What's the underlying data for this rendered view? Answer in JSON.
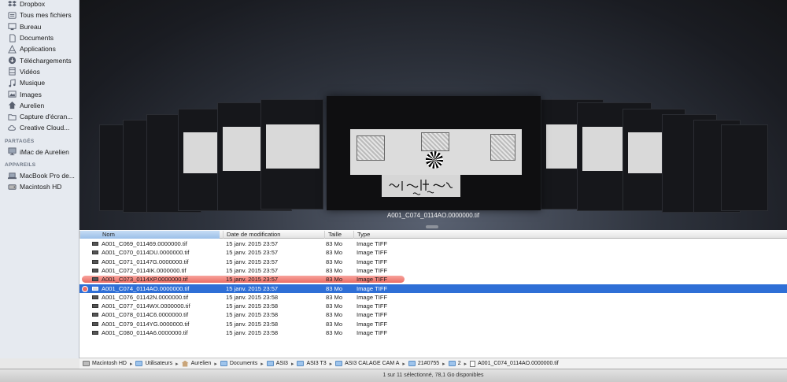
{
  "sidebar": {
    "favorites": [
      {
        "label": "Dropbox",
        "icon": "dropbox-icon"
      },
      {
        "label": "Tous mes fichiers",
        "icon": "all-files-icon"
      },
      {
        "label": "Bureau",
        "icon": "desktop-icon"
      },
      {
        "label": "Documents",
        "icon": "documents-icon"
      },
      {
        "label": "Applications",
        "icon": "applications-icon"
      },
      {
        "label": "Téléchargements",
        "icon": "downloads-icon"
      },
      {
        "label": "Vidéos",
        "icon": "movies-icon"
      },
      {
        "label": "Musique",
        "icon": "music-icon"
      },
      {
        "label": "Images",
        "icon": "pictures-icon"
      },
      {
        "label": "Aurelien",
        "icon": "home-icon"
      },
      {
        "label": "Capture d'écran...",
        "icon": "folder-icon"
      },
      {
        "label": "Creative Cloud...",
        "icon": "creative-cloud-icon"
      }
    ],
    "shared_heading": "PARTAGÉS",
    "shared": [
      {
        "label": "iMac de Aurelien",
        "icon": "imac-icon"
      }
    ],
    "devices_heading": "APPAREILS",
    "devices": [
      {
        "label": "MacBook Pro de...",
        "icon": "laptop-icon"
      },
      {
        "label": "Macintosh HD",
        "icon": "hard-drive-icon"
      }
    ]
  },
  "coverflow": {
    "caption": "A001_C074_0114AO.0000000.tif"
  },
  "columns": {
    "name": "Nom",
    "date": "Date de modification",
    "size": "Taille",
    "type": "Type"
  },
  "files": [
    {
      "name": "A001_C069_011469.0000000.tif",
      "date": "15 janv. 2015 23:57",
      "size": "83 Mo",
      "type": "Image TIFF"
    },
    {
      "name": "A001_C070_0114DU.0000000.tif",
      "date": "15 janv. 2015 23:57",
      "size": "83 Mo",
      "type": "Image TIFF"
    },
    {
      "name": "A001_C071_01147G.0000000.tif",
      "date": "15 janv. 2015 23:57",
      "size": "83 Mo",
      "type": "Image TIFF"
    },
    {
      "name": "A001_C072_0114IK.0000000.tif",
      "date": "15 janv. 2015 23:57",
      "size": "83 Mo",
      "type": "Image TIFF"
    },
    {
      "name": "A001_C073_0114XP.0000000.tif",
      "date": "15 janv. 2015 23:57",
      "size": "83 Mo",
      "type": "Image TIFF"
    },
    {
      "name": "A001_C074_0114AO.0000000.tif",
      "date": "15 janv. 2015 23:57",
      "size": "83 Mo",
      "type": "Image TIFF"
    },
    {
      "name": "A001_C076_01142N.0000000.tif",
      "date": "15 janv. 2015 23:58",
      "size": "83 Mo",
      "type": "Image TIFF"
    },
    {
      "name": "A001_C077_0114WX.0000000.tif",
      "date": "15 janv. 2015 23:58",
      "size": "83 Mo",
      "type": "Image TIFF"
    },
    {
      "name": "A001_C078_0114C6.0000000.tif",
      "date": "15 janv. 2015 23:58",
      "size": "83 Mo",
      "type": "Image TIFF"
    },
    {
      "name": "A001_C079_0114YG.0000000.tif",
      "date": "15 janv. 2015 23:58",
      "size": "83 Mo",
      "type": "Image TIFF"
    },
    {
      "name": "A001_C080_0114A6.0000000.tif",
      "date": "15 janv. 2015 23:58",
      "size": "83 Mo",
      "type": "Image TIFF"
    }
  ],
  "path": [
    {
      "label": "Macintosh HD",
      "icon": "disk"
    },
    {
      "label": "Utilisateurs",
      "icon": "folder"
    },
    {
      "label": "Aurelien",
      "icon": "home"
    },
    {
      "label": "Documents",
      "icon": "folder"
    },
    {
      "label": "ASI3",
      "icon": "folder"
    },
    {
      "label": "ASI3 T3",
      "icon": "folder"
    },
    {
      "label": "ASI3 CALAGE CAM A",
      "icon": "folder"
    },
    {
      "label": "21#0755",
      "icon": "folder"
    },
    {
      "label": "2",
      "icon": "folder"
    },
    {
      "label": "A001_C074_0114AO.0000000.tif",
      "icon": "file"
    }
  ],
  "status": "1 sur 11 sélectionné, 78,1 Go disponibles",
  "colors": {
    "selection": "#2f6fd6",
    "red_label": "#ef6d66",
    "sidebar_bg": "#e6eaf0"
  }
}
